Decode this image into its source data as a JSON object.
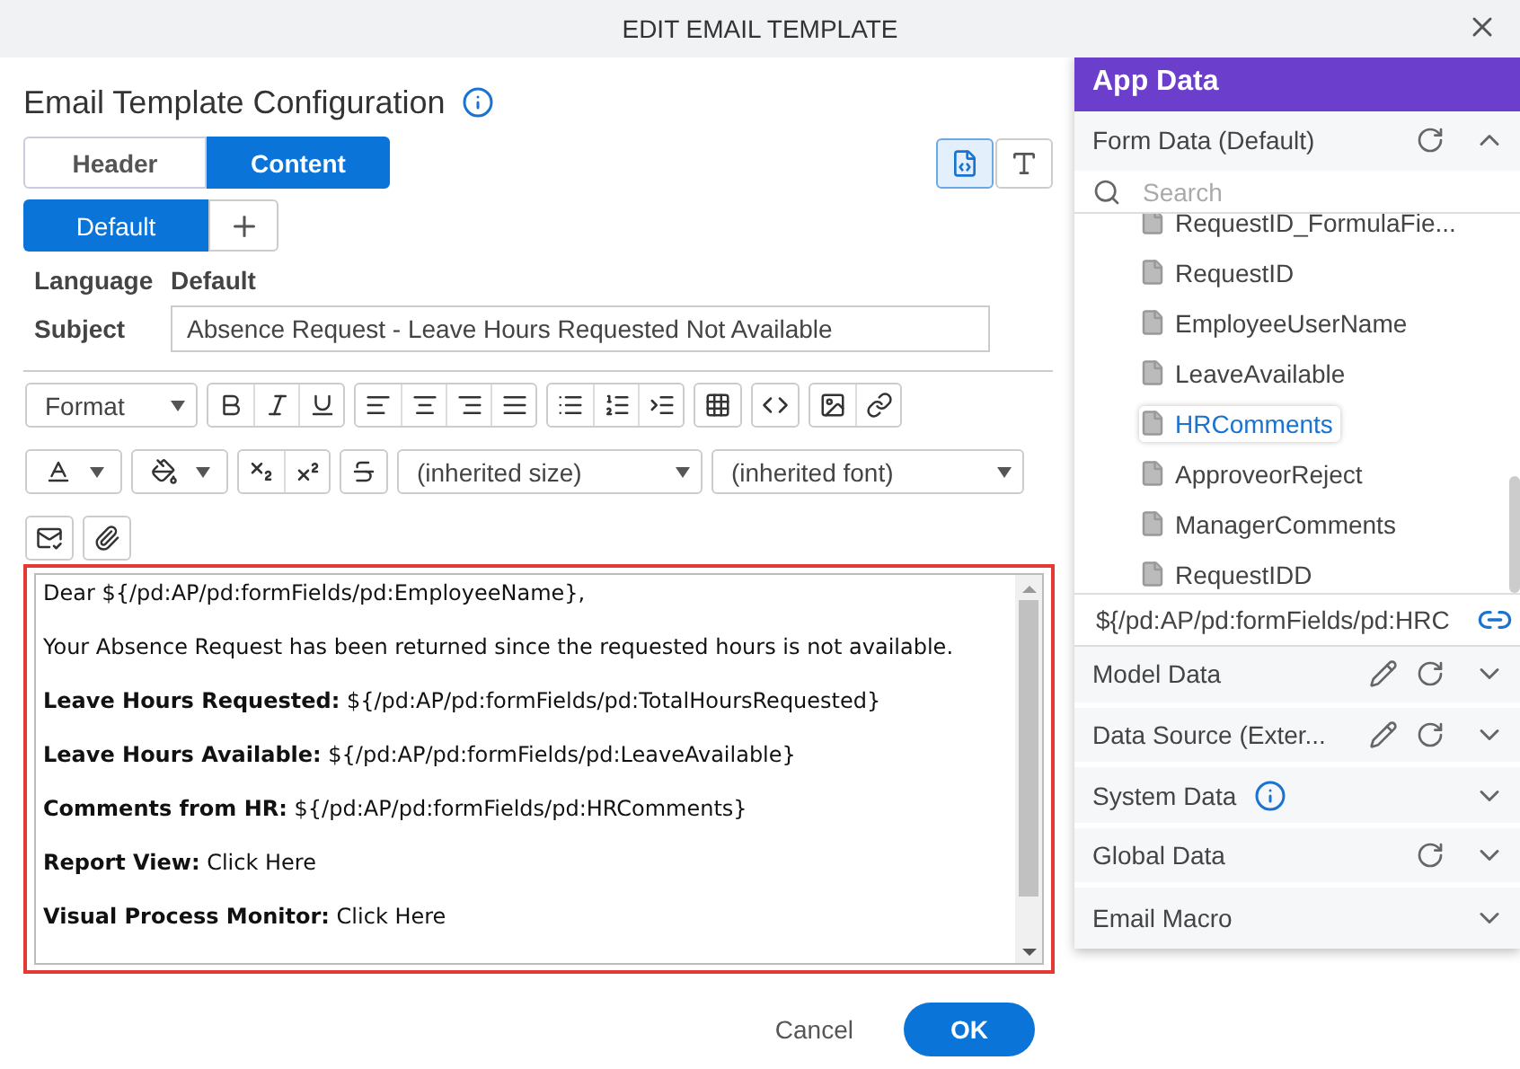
{
  "dialog": {
    "title": "EDIT EMAIL TEMPLATE"
  },
  "config": {
    "title": "Email Template Configuration",
    "tabs": [
      {
        "label": "Header",
        "selected": false
      },
      {
        "label": "Content",
        "selected": true
      }
    ],
    "view_modes": [
      {
        "kind": "source",
        "selected": true
      },
      {
        "kind": "text",
        "selected": false
      }
    ],
    "languages": [
      {
        "label": "Default",
        "selected": true
      }
    ],
    "language": {
      "label": "Language",
      "value": "Default"
    },
    "subject": {
      "label": "Subject",
      "value": "Absence Request - Leave Hours Requested Not Available"
    }
  },
  "toolbar": {
    "format": "Format",
    "size": "(inherited size)",
    "font": "(inherited font)"
  },
  "body": [
    "Dear ${/pd:AP/pd:formFields/pd:EmployeeName},",
    "Your Absence Request has been returned since the requested hours is not available.",
    "**Leave Hours Requested:** ${/pd:AP/pd:formFields/pd:TotalHoursRequested}",
    "**Leave Hours Available:** ${/pd:AP/pd:formFields/pd:LeaveAvailable}",
    "**Comments from HR:** ${/pd:AP/pd:formFields/pd:HRComments}",
    "**Report View:** Click Here",
    "**Visual Process Monitor:** Click Here"
  ],
  "app_data": {
    "title": "App Data",
    "form_data": {
      "title": "Form Data (Default)",
      "expanded": true,
      "search_placeholder": "Search",
      "items": [
        {
          "label": "RequestID_FormulaFie...",
          "selected": false
        },
        {
          "label": "RequestID",
          "selected": false
        },
        {
          "label": "EmployeeUserName",
          "selected": false
        },
        {
          "label": "LeaveAvailable",
          "selected": false
        },
        {
          "label": "HRComments",
          "selected": true
        },
        {
          "label": "ApproveorReject",
          "selected": false
        },
        {
          "label": "ManagerComments",
          "selected": false
        },
        {
          "label": "RequestIDD",
          "selected": false
        }
      ]
    },
    "path": "${/pd:AP/pd:formFields/pd:HRC",
    "sections": [
      {
        "title": "Model Data",
        "expanded": false,
        "tools": [
          {
            "kind": "edit"
          },
          {
            "kind": "refresh"
          }
        ]
      },
      {
        "title": "Data Source (Exter...",
        "expanded": false,
        "tools": [
          {
            "kind": "edit"
          },
          {
            "kind": "refresh"
          }
        ]
      },
      {
        "title": "System Data",
        "expanded": false,
        "tools": [
          {
            "kind": "info"
          }
        ]
      },
      {
        "title": "Global Data",
        "expanded": false,
        "tools": [
          {
            "kind": "refresh"
          }
        ]
      },
      {
        "title": "Email Macro",
        "expanded": false
      }
    ]
  },
  "footer": {
    "cancel": "Cancel",
    "ok": "OK"
  }
}
